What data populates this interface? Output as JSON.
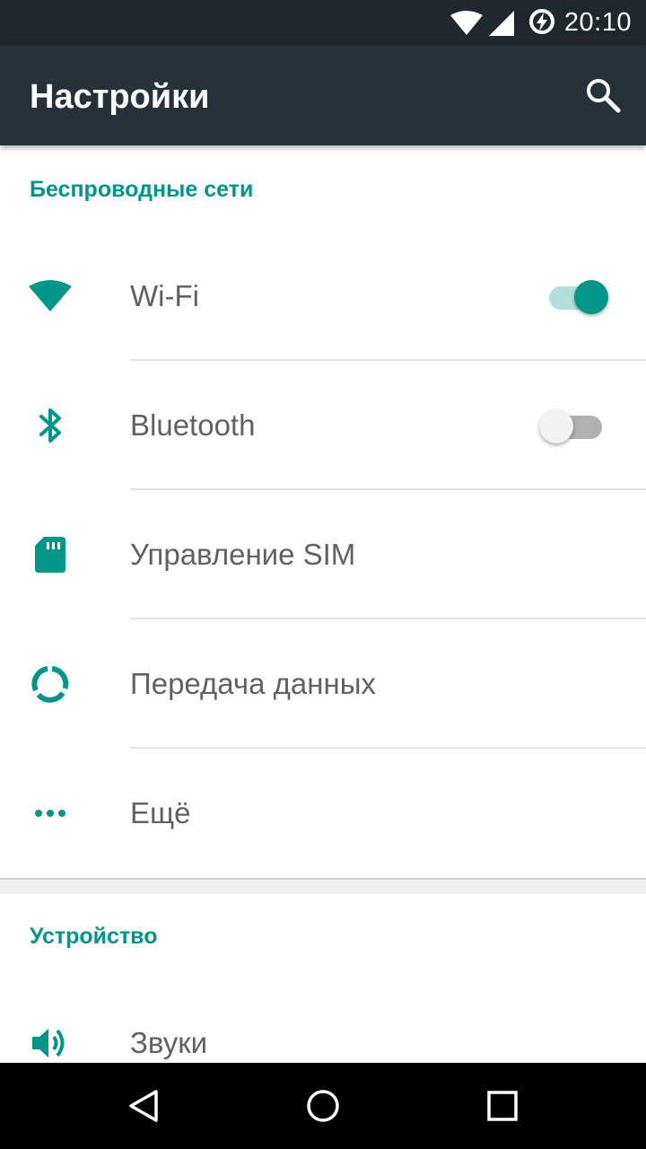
{
  "status_bar": {
    "time": "20:10",
    "icons": [
      "wifi-icon",
      "signal-icon",
      "battery-charging-icon"
    ]
  },
  "toolbar": {
    "title": "Настройки",
    "search_icon": "search-icon"
  },
  "sections": [
    {
      "header": "Беспроводные сети",
      "items": [
        {
          "label": "Wi-Fi",
          "icon": "wifi-icon",
          "switch": "on"
        },
        {
          "label": "Bluetooth",
          "icon": "bluetooth-icon",
          "switch": "off"
        },
        {
          "label": "Управление SIM",
          "icon": "sim-card-icon"
        },
        {
          "label": "Передача данных",
          "icon": "data-usage-icon"
        },
        {
          "label": "Ещё",
          "icon": "more-icon"
        }
      ]
    },
    {
      "header": "Устройство",
      "items": [
        {
          "label": "Звуки",
          "icon": "volume-icon"
        }
      ]
    }
  ],
  "nav_bar": {
    "buttons": [
      "back-icon",
      "home-icon",
      "recents-icon"
    ]
  },
  "colors": {
    "accent": "#009688",
    "toolbar": "#263238",
    "status_bar": "#20282c"
  }
}
